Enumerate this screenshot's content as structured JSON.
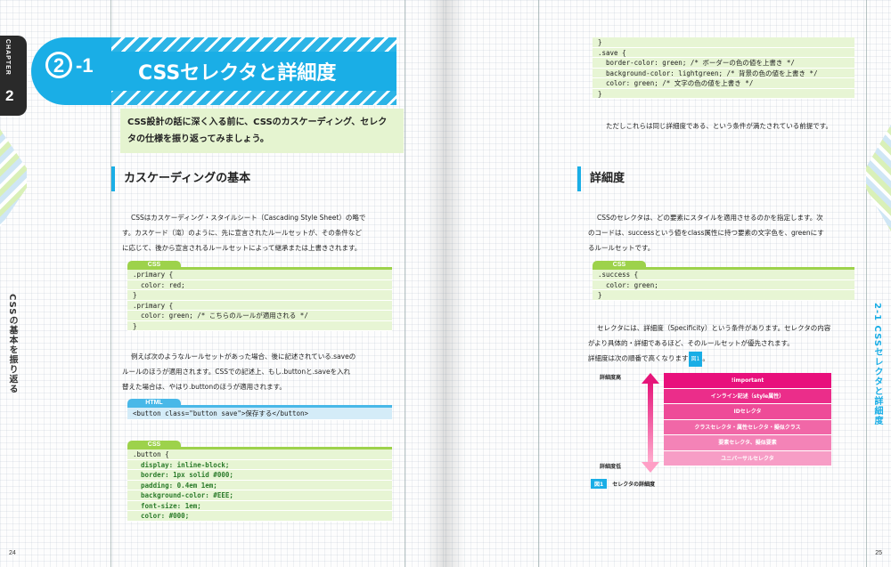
{
  "left_page": {
    "chapter_label": "CHAPTER",
    "chapter_number": "2",
    "vertical_title": "CSSの基本を振り返る",
    "section_number": "2",
    "section_sub": "-1",
    "section_title": "CSSセレクタと詳細度",
    "intro_line1": "CSS設計の話に深く入る前に、CSSのカスケーディング、セレク",
    "intro_line2": "タの仕様を振り返ってみましょう。",
    "heading": "カスケーディングの基本",
    "para1_line1": "CSSはカスケーディング・スタイルシート（Cascading Style Sheet）の略で",
    "para1_line2": "す。カスケード（滝）のように、先に宣言されたルールセットが、その条件など",
    "para1_line3": "に応じて、後から宣言されるルールセットによって継承または上書きされます。",
    "code1": {
      "label": "CSS",
      "lines": [
        ".primary {",
        "  color: red;",
        "}",
        ".primary {",
        "  color: green; /* こちらのルールが適用される */",
        "}"
      ]
    },
    "para2_line1": "例えば次のようなルールセットがあった場合、後に記述されている.saveの",
    "para2_line2": "ルールのほうが適用されます。CSSでの記述上、もし.buttonと.saveを入れ",
    "para2_line3": "替えた場合は、やはり.buttonのほうが適用されます。",
    "code2": {
      "label": "HTML",
      "lines": [
        "<button class=\"button save\">保存する</button>"
      ]
    },
    "code3": {
      "label": "CSS",
      "lines": [
        ".button {",
        "  display: inline-block;",
        "  border: 1px solid #000;",
        "  padding: 0.4em 1em;",
        "  background-color: #EEE;",
        "  font-size: 1em;",
        "  color: #000;"
      ]
    },
    "page_number": "24"
  },
  "right_page": {
    "vertical_title": "2-1 CSSセレクタと詳細度",
    "code1": {
      "label": "",
      "lines": [
        "}",
        ".save {",
        "  border-color: green; /* ボーダーの色の値を上書き */",
        "  background-color: lightgreen; /* 背景の色の値を上書き */",
        "  color: green; /* 文字の色の値を上書き */",
        "}"
      ]
    },
    "para1": "ただしこれらは同じ詳細度である、という条件が満たされている前提です。",
    "heading": "詳細度",
    "para2_line1": "CSSのセレクタは、どの要素にスタイルを適用させるのかを指定します。次",
    "para2_line2": "のコードは、successという値をclass属性に持つ要素の文字色を、greenにす",
    "para2_line3": "るルールセットです。",
    "code2": {
      "label": "CSS",
      "lines": [
        ".success {",
        "  color: green;",
        "}"
      ]
    },
    "para3_line1": "セレクタには、詳細度（Specificity）という条件があります。セレクタの内容",
    "para3_line2": "がより具体的・詳細であるほど、そのルールセットが優先されます。",
    "para3_line3": "詳細度は次の順番で高くなります",
    "fig_ref": "図1",
    "para3_end": "。",
    "diagram": {
      "top_label": "詳細度高",
      "bottom_label": "詳細度低",
      "rows": [
        {
          "text": "!important",
          "color": "#e8107c"
        },
        {
          "text": "インライン記述（style属性）",
          "color": "#eb2d8a"
        },
        {
          "text": "IDセレクタ",
          "color": "#ee4b98"
        },
        {
          "text": "クラスセレクタ・属性セレクタ・擬似クラス",
          "color": "#f167a7"
        },
        {
          "text": "要素セレクタ、擬似要素",
          "color": "#f483b7"
        },
        {
          "text": "ユニバーサルセレクタ",
          "color": "#f79dc6"
        }
      ]
    },
    "fig_caption_tag": "図1",
    "fig_caption": "セレクタの詳細度",
    "page_number": "25"
  }
}
